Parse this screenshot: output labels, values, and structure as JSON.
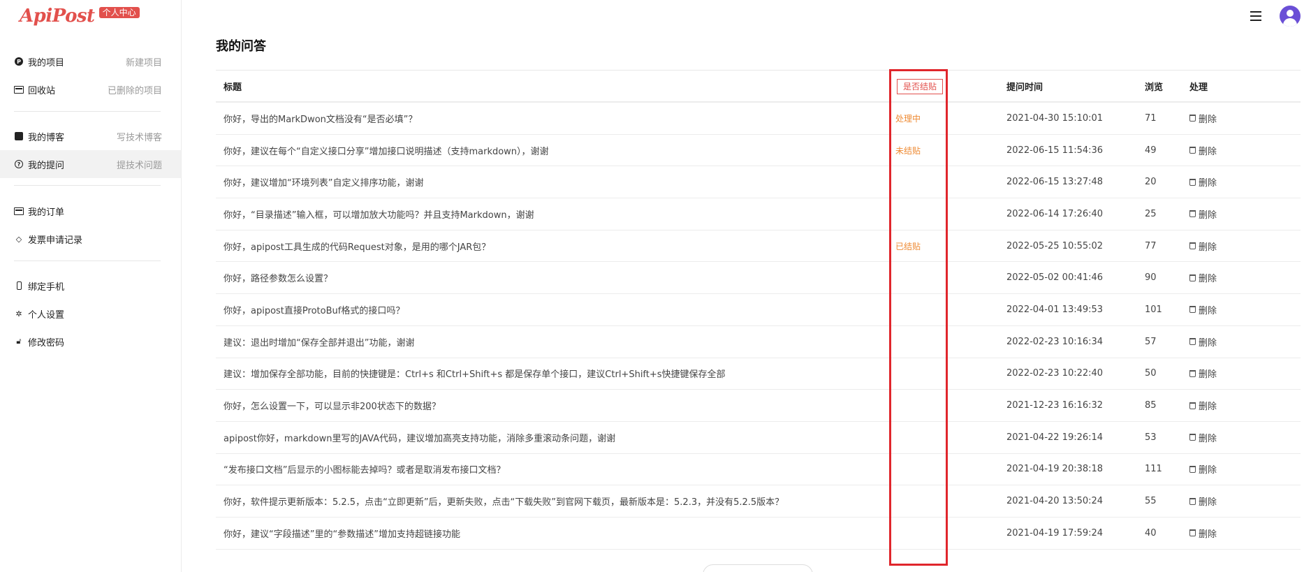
{
  "logo": {
    "text": "ApiPost",
    "badge": "个人中心"
  },
  "sidebar": {
    "groups": [
      [
        {
          "icon": "p-circle-icon",
          "label": "我的项目",
          "sub": "新建项目"
        },
        {
          "icon": "id-card-icon",
          "label": "回收站",
          "sub": "已删除的项目"
        }
      ],
      [
        {
          "icon": "rss-icon",
          "label": "我的博客",
          "sub": "写技术博客"
        },
        {
          "icon": "question-circle-icon",
          "label": "我的提问",
          "sub": "提技术问题",
          "active": true
        }
      ],
      [
        {
          "icon": "credit-card-icon",
          "label": "我的订单",
          "sub": ""
        },
        {
          "icon": "receipt-icon",
          "label": "发票申请记录",
          "sub": ""
        }
      ],
      [
        {
          "icon": "phone-icon",
          "label": "绑定手机",
          "sub": ""
        },
        {
          "icon": "gear-icon",
          "label": "个人设置",
          "sub": ""
        },
        {
          "icon": "lock-icon",
          "label": "修改密码",
          "sub": ""
        }
      ]
    ]
  },
  "page_title": "我的问答",
  "table": {
    "headers": {
      "title": "标题",
      "status": "是否结贴",
      "time": "提问时间",
      "views": "浏览",
      "action": "处理"
    },
    "delete_label": "删除",
    "rows": [
      {
        "title": "你好，导出的MarkDwon文档没有“是否必填”？",
        "status": "处理中",
        "time": "2021-04-30 15:10:01",
        "views": "71"
      },
      {
        "title": "你好，建议在每个“自定义接口分享”增加接口说明描述（支持markdown），谢谢",
        "status": "未结贴",
        "time": "2022-06-15 11:54:36",
        "views": "49"
      },
      {
        "title": "你好，建议增加“环境列表”自定义排序功能，谢谢",
        "status": "",
        "time": "2022-06-15 13:27:48",
        "views": "20"
      },
      {
        "title": "你好，“目录描述”输入框，可以增加放大功能吗？并且支持Markdown，谢谢",
        "status": "",
        "time": "2022-06-14 17:26:40",
        "views": "25"
      },
      {
        "title": "你好，apipost工具生成的代码Request对象，是用的哪个JAR包？",
        "status": "已结贴",
        "time": "2022-05-25 10:55:02",
        "views": "77"
      },
      {
        "title": "你好，路径参数怎么设置？",
        "status": "",
        "time": "2022-05-02 00:41:46",
        "views": "90"
      },
      {
        "title": "你好，apipost直接ProtoBuf格式的接口吗？",
        "status": "",
        "time": "2022-04-01 13:49:53",
        "views": "101"
      },
      {
        "title": "建议：退出时增加“保存全部并退出”功能，谢谢",
        "status": "",
        "time": "2022-02-23 10:16:34",
        "views": "57"
      },
      {
        "title": "建议：增加保存全部功能，目前的快捷键是：Ctrl+s 和Ctrl+Shift+s 都是保存单个接口，建议Ctrl+Shift+s快捷键保存全部",
        "status": "",
        "time": "2022-02-23 10:22:40",
        "views": "50"
      },
      {
        "title": "你好，怎么设置一下，可以显示非200状态下的数据？",
        "status": "",
        "time": "2021-12-23 16:16:32",
        "views": "85"
      },
      {
        "title": "apipost你好，markdown里写的JAVA代码，建议增加高亮支持功能，消除多重滚动条问题，谢谢",
        "status": "",
        "time": "2021-04-22 19:26:14",
        "views": "53"
      },
      {
        "title": "“发布接口文档”后显示的小图标能去掉吗？或者是取消发布接口文档？",
        "status": "",
        "time": "2021-04-19 20:38:18",
        "views": "111"
      },
      {
        "title": "你好，软件提示更新版本：5.2.5，点击“立即更新”后，更新失败，点击“下载失败”到官网下载页，最新版本是：5.2.3，并没有5.2.5版本？",
        "status": "",
        "time": "2021-04-20 13:50:24",
        "views": "55"
      },
      {
        "title": "你好，建议“字段描述”里的“参数描述”增加支持超链接功能",
        "status": "",
        "time": "2021-04-19 17:59:24",
        "views": "40"
      }
    ]
  },
  "colors": {
    "brand": "#e2504c",
    "status_text": "#ee8a33",
    "highlight_box": "#e0262c",
    "avatar": "#6a4fd6"
  }
}
